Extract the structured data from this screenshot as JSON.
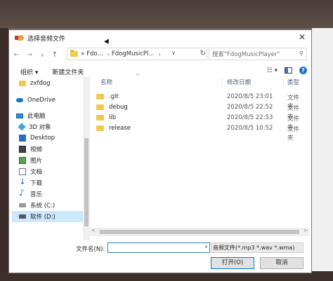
{
  "dialog": {
    "title": "选择音频文件",
    "close": "✕"
  },
  "nav": {
    "back": "←",
    "forward": "→",
    "dropdown": "∨",
    "up": "↑",
    "breadcrumb_prefix": "«",
    "breadcrumbs": [
      "Fdo...",
      "FdogMusicPl..."
    ],
    "sep": "›",
    "addr_dropdown": "∨",
    "refresh": "↻",
    "search_placeholder": "搜索\"FdogMusicPlayer\"",
    "search_icon": "⚲"
  },
  "toolbar": {
    "organize": "组织 ▾",
    "new_folder": "新建文件夹",
    "view_icon": "☷ ▾",
    "help": "?"
  },
  "navpane": {
    "items": [
      {
        "label": "zxfdog",
        "icon": "folder-icon"
      },
      {
        "label": "OneDrive",
        "icon": "cloud-icon"
      },
      {
        "label": "此电脑",
        "icon": "computer-icon"
      },
      {
        "label": "3D 对象",
        "icon": "3d-objects-icon"
      },
      {
        "label": "Desktop",
        "icon": "desktop-icon"
      },
      {
        "label": "视频",
        "icon": "video-icon"
      },
      {
        "label": "图片",
        "icon": "pictures-icon"
      },
      {
        "label": "文档",
        "icon": "documents-icon"
      },
      {
        "label": "下载",
        "icon": "downloads-icon"
      },
      {
        "label": "音乐",
        "icon": "music-icon"
      },
      {
        "label": "系统 (C:)",
        "icon": "drive-icon"
      },
      {
        "label": "软件 (D:)",
        "icon": "drive-icon"
      }
    ]
  },
  "filelist": {
    "columns": {
      "name": "名称",
      "date": "修改日期",
      "type": "类型"
    },
    "sort_indicator": "^",
    "rows": [
      {
        "name": ".git",
        "date": "2020/8/5 23:01",
        "type": "文件夹"
      },
      {
        "name": "debug",
        "date": "2020/8/5 22:52",
        "type": "文件夹"
      },
      {
        "name": "lib",
        "date": "2020/8/5 22:53",
        "type": "文件夹"
      },
      {
        "name": "release",
        "date": "2020/8/5 10:52",
        "type": "文件夹"
      }
    ]
  },
  "bottom": {
    "filename_label": "文件名(N):",
    "filename_value": "",
    "filename_dropdown": "∨",
    "filetype": "音频文件(*.mp3 *.wav *.wma)",
    "open_button": "打开(O)",
    "cancel_button": "取消"
  },
  "scroll": {
    "left": "<",
    "right": ">"
  }
}
